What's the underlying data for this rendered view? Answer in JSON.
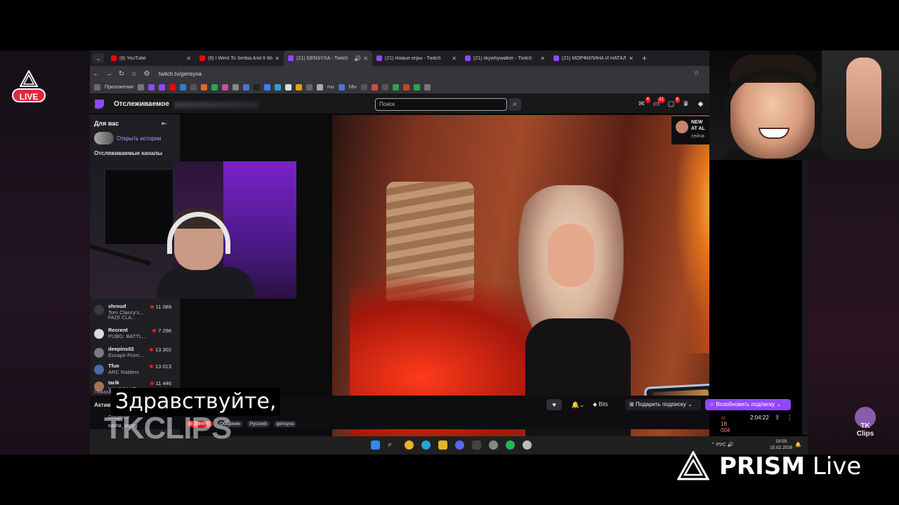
{
  "overlay": {
    "live_label": "LIVE",
    "prism_brand": "PRISM",
    "prism_suffix": "Live",
    "tk_badge": "TK Clips",
    "watermark": "TKCLIPS",
    "subtitle": "Здравствуйте,"
  },
  "browser": {
    "tabs": [
      {
        "title": "(8) YouTube",
        "color": "#ff0000",
        "active": false
      },
      {
        "title": "(8) I Went To Serbia And It Wa",
        "color": "#ff0000",
        "active": false
      },
      {
        "title": "(21) GENSYXA - Twitch",
        "color": "#9147ff",
        "active": true
      },
      {
        "title": "(21) Новые игры - Twitch",
        "color": "#9147ff",
        "active": false
      },
      {
        "title": "(21) skywhywalker - Twitch",
        "color": "#9147ff",
        "active": false
      },
      {
        "title": "(21) МОРФИЛИНА И НАТАЛЬ",
        "color": "#9147ff",
        "active": false
      }
    ],
    "url": "twitch.tv/gensyxa",
    "bookmarks_label": "Приложения",
    "bookmark_folder": "mu",
    "bookmark_hltv": "hltv"
  },
  "twitch": {
    "nav_followed": "Отслеживаемое",
    "search_placeholder": "Поиск",
    "notif_counts": [
      "4",
      "21",
      "6"
    ],
    "sidebar": {
      "heading": "Для вас",
      "open_history": "Открыть истории",
      "followed_heading": "Отслеживаемые каналы",
      "show_more": "Показать",
      "active_heading": "Активн",
      "channels": [
        {
          "name": "deepins02",
          "game": "Escape From...",
          "viewers": "13 302",
          "color": "#7a7a7a",
          "tag": ""
        },
        {
          "name": "Tfue",
          "game": "ARC Raiders",
          "viewers": "13 013",
          "color": "#4a6aa8",
          "tag": ""
        },
        {
          "name": "tarik",
          "game": "VALORANT",
          "viewers": "11 446",
          "color": "#a8744a",
          "tag": ""
        },
        {
          "name": "shroud",
          "game": "Tom Clancy's...",
          "viewers": "11 089",
          "color": "#3a3a3a",
          "tag": "FAZE CLA..."
        },
        {
          "name": "Recrent",
          "game": "PUBG: BATTL...",
          "viewers": "7 296",
          "color": "#dddddd",
          "tag": ""
        }
      ],
      "activity": [
        {
          "name": "Общение"
        },
        {
          "name": "sasha_sapog"
        }
      ]
    },
    "channel_overlay": {
      "title": "NEW AT AL",
      "time": "сейча"
    },
    "controls": {
      "bits": "Bits",
      "gift": "Подарить подписку",
      "resub": "Возобновить подписку",
      "viewers": "18 004",
      "uptime": "2:04:22"
    },
    "tags": {
      "live": "В ЭФИРЕ",
      "cat": "Общение",
      "lang": "Русский",
      "name": "gensyxa"
    }
  },
  "taskbar": {
    "lang": "РУС",
    "time": "19:59",
    "date": "15.02.2026"
  }
}
